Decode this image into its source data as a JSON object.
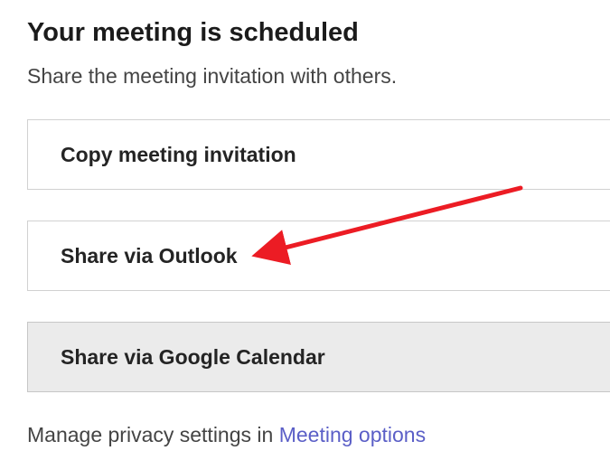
{
  "heading": "Your meeting is scheduled",
  "subheading": "Share the meeting invitation with others.",
  "options": {
    "copy": "Copy meeting invitation",
    "outlook": "Share via Outlook",
    "google": "Share via Google Calendar"
  },
  "manage": {
    "prefix": "Manage privacy settings in ",
    "link": "Meeting options"
  }
}
